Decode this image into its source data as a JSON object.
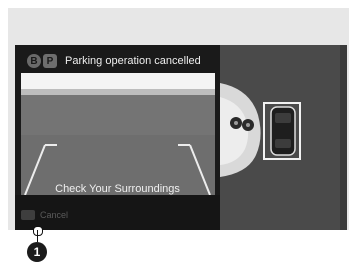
{
  "status": {
    "icon_a": "B",
    "icon_p": "P",
    "message": "Parking operation cancelled"
  },
  "camera": {
    "hint": "Check Your Surroundings"
  },
  "footer": {
    "cancel_label": "Cancel"
  },
  "callout": {
    "number": "1"
  },
  "icons": {
    "mode": "brake-hold-icon",
    "park": "parking-icon",
    "cancel": "cancel-key-icon"
  }
}
